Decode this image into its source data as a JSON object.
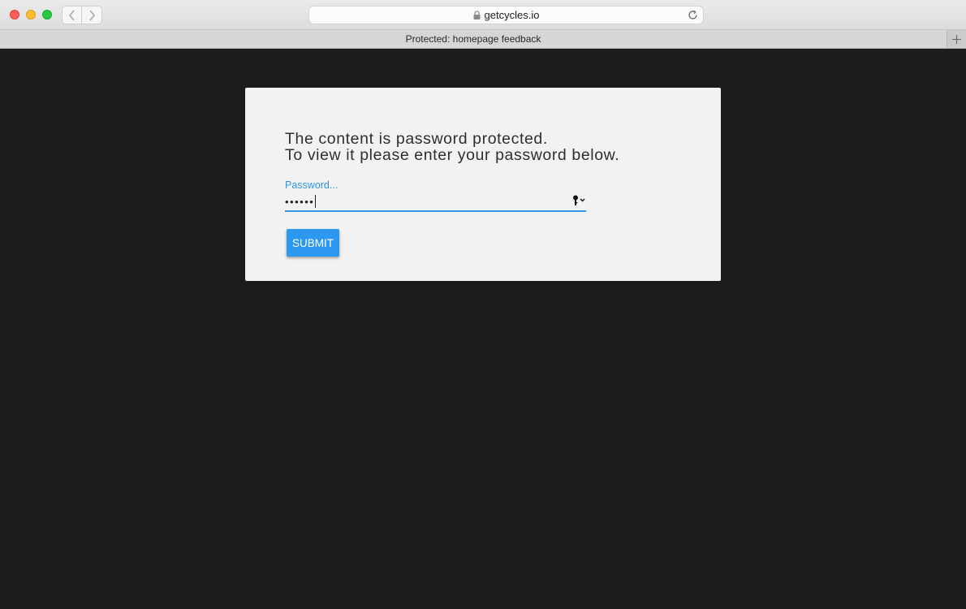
{
  "browser": {
    "url": "getcycles.io",
    "tab_title": "Protected: homepage feedback",
    "icons": {
      "back": "chevron-left-icon",
      "forward": "chevron-right-icon",
      "lock": "lock-icon",
      "reload": "reload-icon",
      "new_tab": "plus-icon"
    }
  },
  "form": {
    "heading_line1": "The content is password protected.",
    "heading_line2": "To view it please enter your password below.",
    "password_label": "Password...",
    "password_value": "••••••",
    "submit_label": "SUBMIT",
    "keychain_icon": "key-icon"
  },
  "colors": {
    "accent": "#2d98f0",
    "page_background": "#1c1c1c",
    "card_background": "#f2f2f2"
  }
}
